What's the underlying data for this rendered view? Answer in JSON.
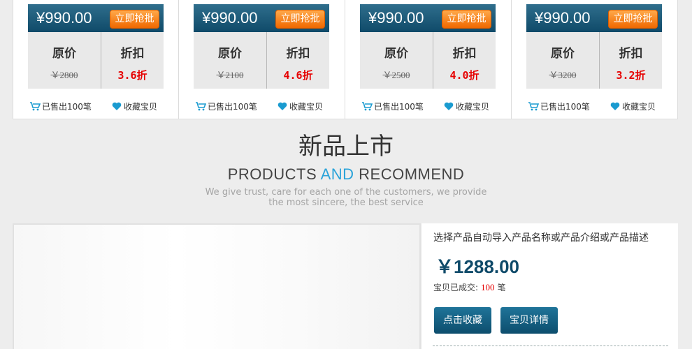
{
  "cards": [
    {
      "price": "¥990.00",
      "buy_label": "立即抢批",
      "orig_label": "原价",
      "orig_price": "￥2800",
      "disc_label": "折扣",
      "discount": "3.6折",
      "sold": "已售出100笔",
      "fav": "收藏宝贝"
    },
    {
      "price": "¥990.00",
      "buy_label": "立即抢批",
      "orig_label": "原价",
      "orig_price": "￥2100",
      "disc_label": "折扣",
      "discount": "4.6折",
      "sold": "已售出100笔",
      "fav": "收藏宝贝"
    },
    {
      "price": "¥990.00",
      "buy_label": "立即抢批",
      "orig_label": "原价",
      "orig_price": "￥2500",
      "disc_label": "折扣",
      "discount": "4.0折",
      "sold": "已售出100笔",
      "fav": "收藏宝贝"
    },
    {
      "price": "¥990.00",
      "buy_label": "立即抢批",
      "orig_label": "原价",
      "orig_price": "￥3200",
      "disc_label": "折扣",
      "discount": "3.2折",
      "sold": "已售出100笔",
      "fav": "收藏宝贝"
    }
  ],
  "section": {
    "title_cn": "新品上市",
    "title_en_1": "PRODUCTS ",
    "title_en_hl": "AND",
    "title_en_2": " RECOMMEND",
    "desc_1": "We give trust, care for each one of the customers, we provide",
    "desc_2": "the most sincere, the best service"
  },
  "product": {
    "title": "选择产品自动导入产品名称或产品介绍或产品描述",
    "price": "￥1288.00",
    "sold_label": "宝贝已成交:",
    "sold_count": "100",
    "sold_unit": "笔",
    "fav_button": "点击收藏",
    "detail_button": "宝贝详情"
  },
  "icons": {
    "cart": "cart-icon",
    "heart": "heart-icon"
  },
  "colors": {
    "accent_blue": "#0f4a69",
    "buy_orange": "#f06800",
    "discount_red": "#e60000",
    "highlight_blue": "#2aa3d9"
  }
}
